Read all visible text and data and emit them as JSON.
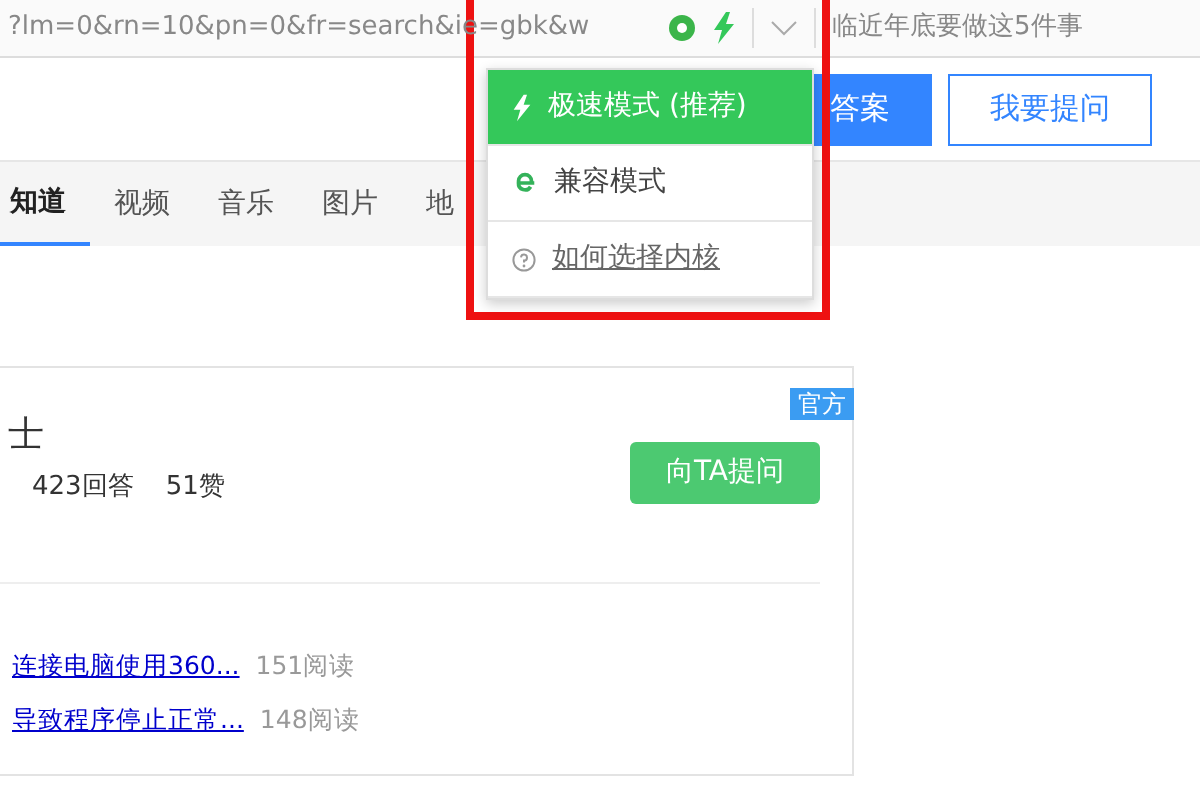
{
  "address_bar": {
    "url": "?lm=0&rn=10&pn=0&fr=search&ie=gbk&w",
    "headline": "临近年底要做这5件事"
  },
  "search": {
    "buttons": [
      {
        "label": "答案",
        "kind": "primary"
      },
      {
        "label": "我要提问",
        "kind": "outline"
      }
    ]
  },
  "tabs": [
    {
      "label": "知道",
      "selected": true
    },
    {
      "label": "视频",
      "selected": false
    },
    {
      "label": "音乐",
      "selected": false
    },
    {
      "label": "图片",
      "selected": false
    },
    {
      "label": "地",
      "selected": false
    }
  ],
  "kernel_menu": {
    "items": [
      {
        "label": "极速模式 (推荐)",
        "kind": "fast",
        "selected": true
      },
      {
        "label": "兼容模式",
        "kind": "compat",
        "selected": false
      },
      {
        "label": "如何选择内核",
        "kind": "help",
        "selected": false
      }
    ]
  },
  "profile_card": {
    "badge": "官方",
    "name": "士",
    "stats": [
      "423回答",
      "51赞"
    ],
    "ask_button": "向TA提问",
    "articles": [
      {
        "title": "连接电脑使用360...",
        "reads": "151阅读"
      },
      {
        "title": "导致程序停止正常...",
        "reads": "148阅读"
      }
    ]
  }
}
